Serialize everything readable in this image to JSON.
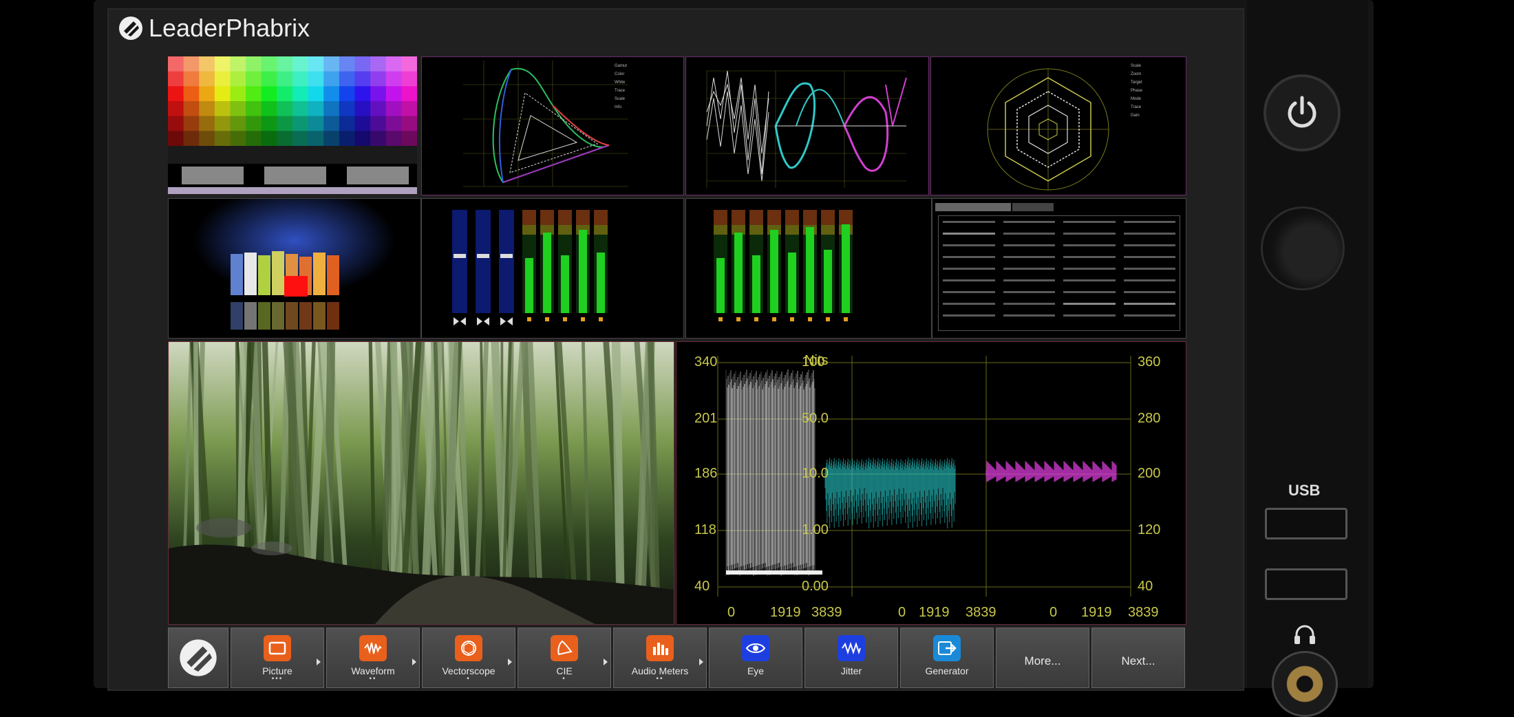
{
  "brand": {
    "name": "LeaderPhabrix"
  },
  "hardware": {
    "usb_label": "USB"
  },
  "waveform": {
    "nits_label": "Nits",
    "left_scale": [
      "340",
      "201",
      "186",
      "118",
      "40"
    ],
    "nits_scale": [
      "100",
      "50.0",
      "10.0",
      "1.00",
      "0.00"
    ],
    "right_scale": [
      "360",
      "280",
      "200",
      "120",
      "40"
    ],
    "x_ticks": [
      "0",
      "1919",
      "3839",
      "0",
      "1919",
      "3839",
      "0",
      "1919",
      "3839"
    ]
  },
  "toolbar": {
    "items": [
      {
        "label": "Picture",
        "dots": "•••",
        "icon": "picture-icon",
        "color": "#e8601c",
        "arrow": true
      },
      {
        "label": "Waveform",
        "dots": "••",
        "icon": "waveform-icon",
        "color": "#e8601c",
        "arrow": true
      },
      {
        "label": "Vectorscope",
        "dots": "•",
        "icon": "vectorscope-icon",
        "color": "#e8601c",
        "arrow": true
      },
      {
        "label": "CIE",
        "dots": "•",
        "icon": "cie-icon",
        "color": "#e8601c",
        "arrow": true
      },
      {
        "label": "Audio Meters",
        "dots": "••",
        "icon": "audio-meters-icon",
        "color": "#e8601c",
        "arrow": true
      },
      {
        "label": "Eye",
        "dots": "",
        "icon": "eye-icon",
        "color": "#1e3fe0",
        "arrow": false
      },
      {
        "label": "Jitter",
        "dots": "",
        "icon": "jitter-icon",
        "color": "#1e3fe0",
        "arrow": false
      },
      {
        "label": "Generator",
        "dots": "",
        "icon": "generator-icon",
        "color": "#1a8ad8",
        "arrow": false
      },
      {
        "label": "More...",
        "dots": "",
        "icon": "",
        "color": "",
        "arrow": false
      },
      {
        "label": "Next...",
        "dots": "",
        "icon": "",
        "color": "",
        "arrow": false
      }
    ]
  }
}
